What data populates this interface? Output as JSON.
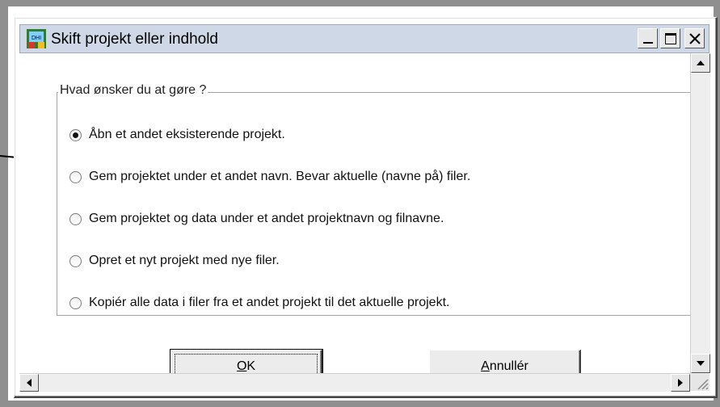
{
  "window": {
    "title": "Skift projekt eller indhold"
  },
  "group": {
    "title": "Hvad ønsker du at gøre ?",
    "options": [
      {
        "label": "Åbn et andet eksisterende projekt.",
        "checked": true
      },
      {
        "label": "Gem projektet under et andet navn. Bevar aktuelle (navne på) filer.",
        "checked": false
      },
      {
        "label": "Gem projektet og data  under et andet projektnavn og filnavne.",
        "checked": false
      },
      {
        "label": "Opret et nyt projekt med nye filer.",
        "checked": false
      },
      {
        "label": "Kopiér alle data i filer fra et andet projekt til det aktuelle projekt.",
        "checked": false
      }
    ]
  },
  "buttons": {
    "ok": {
      "mnemonic": "O",
      "rest": "K"
    },
    "cancel": {
      "mnemonic": "A",
      "rest": "nnullér"
    }
  },
  "icons": {
    "app": "dhi-app-icon",
    "minimize": "minimize-icon",
    "maximize": "maximize-icon",
    "close": "close-icon",
    "pointer_annotation": "arrow-annotation"
  }
}
